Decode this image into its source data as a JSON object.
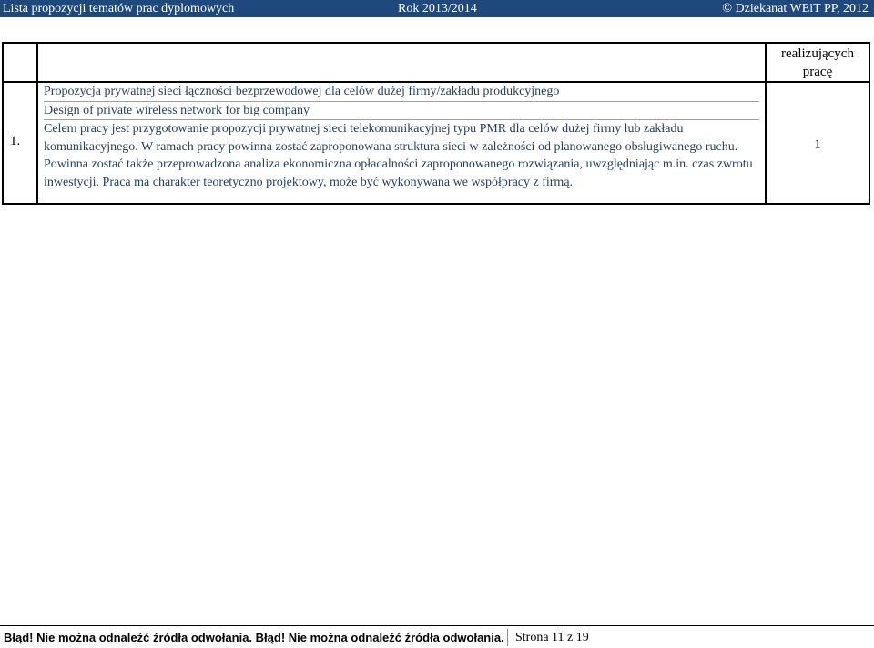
{
  "header": {
    "left": "Lista propozycji tematów prac dyplomowych",
    "center": "Rok 2013/2014",
    "right": "© Dziekanat WEiT PP, 2012"
  },
  "table": {
    "column_header": "realizujących pracę",
    "row": {
      "number": "1.",
      "title_pl": "Propozycja prywatnej sieci łączności bezprzewodowej dla celów dużej firmy/zakładu produkcyjnego",
      "title_en": "Design of private wireless network for big company",
      "description": "Celem pracy jest przygotowanie propozycji prywatnej sieci telekomunikacyjnej typu PMR dla celów dużej firmy lub zakładu komunikacyjnego. W ramach pracy powinna zostać zaproponowana struktura sieci w zależności od planowanego obsługiwanego ruchu. Powinna zostać także przeprowadzona analiza ekonomiczna opłacalności zaproponowanego rozwiązania, uwzględniając m.in. czas zwrotu inwestycji. Praca ma charakter teoretyczno projektowy, może być wykonywana we współpracy z firmą.",
      "count": "1"
    }
  },
  "footer": {
    "error_text": "Błąd! Nie można odnaleźć źródła odwołania. Błąd! Nie można odnaleźć źródła odwołania.",
    "page_info": "Strona 11 z 19"
  }
}
